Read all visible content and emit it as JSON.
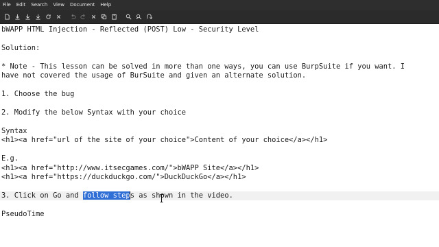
{
  "menubar": {
    "items": [
      "File",
      "Edit",
      "Search",
      "View",
      "Document",
      "Help"
    ]
  },
  "toolbar": {
    "buttons": [
      {
        "icon": "new-file-icon"
      },
      {
        "icon": "open-folder-icon"
      },
      {
        "icon": "save-icon"
      },
      {
        "icon": "save-as-icon"
      },
      {
        "icon": "reload-icon"
      },
      {
        "icon": "close-icon"
      },
      {
        "icon": "undo-icon"
      },
      {
        "icon": "redo-icon"
      },
      {
        "icon": "cut-icon"
      },
      {
        "icon": "copy-icon"
      },
      {
        "icon": "paste-icon"
      },
      {
        "icon": "find-icon"
      },
      {
        "icon": "find-replace-icon"
      },
      {
        "icon": "go-to-icon"
      }
    ]
  },
  "editor": {
    "lines": [
      "bWAPP HTML Injection - Reflected (POST) Low - Security Level",
      "",
      "Solution:",
      "",
      "* Note - This lesson can be solved in more than one ways, you can use BurpSuite if you want. I",
      "have not covered the usage of BurSuite and given an alternate solution.",
      "",
      "1. Choose the bug",
      "",
      "2. Modify the below Syntax with your choice",
      "",
      "Syntax",
      "<h1><a href=\"url of the site of your choice\">Content of your choice</a></h1>",
      "",
      "E.g.",
      "<h1><a href=\"http://www.itsecgames.com/\">bWAPP Site</a></h1>",
      "<h1><a href=\"https://duckduckgo.com/\">DuckDuckGo</a></h1>",
      "",
      "",
      "",
      "PseudoTime"
    ],
    "current_line": {
      "before": "3. Click on Go and ",
      "selected": "follow step",
      "after": "s as shown in the video."
    }
  }
}
